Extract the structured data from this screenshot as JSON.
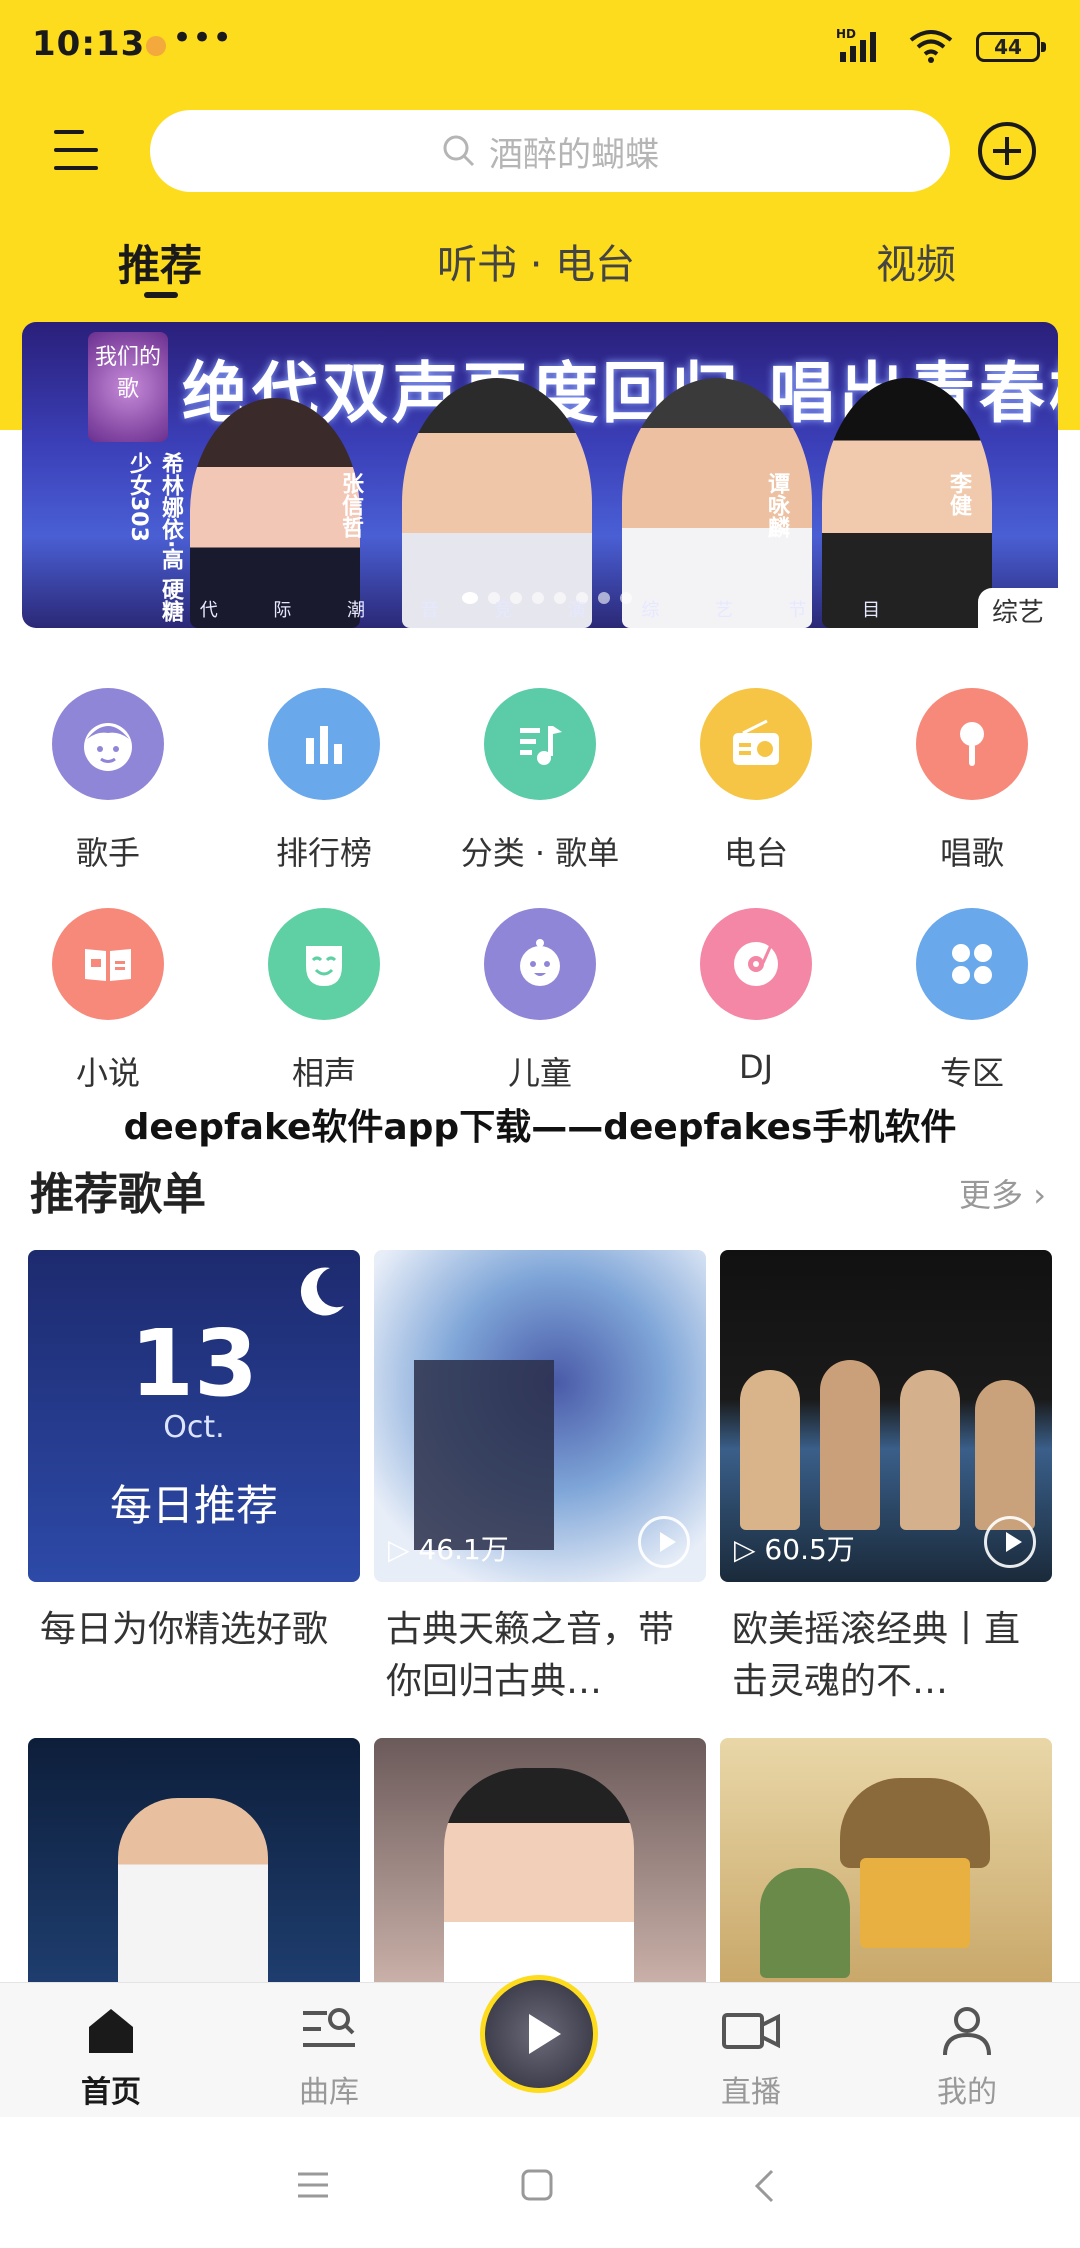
{
  "status_bar": {
    "time": "10:13",
    "dots": "•••",
    "network": "HD",
    "battery": "44"
  },
  "header": {
    "search_placeholder": "酒醉的蝴蝶"
  },
  "tabs": [
    {
      "label": "推荐"
    },
    {
      "label": "听书 · 电台"
    },
    {
      "label": "视频"
    }
  ],
  "banner": {
    "title": "绝代双声再度回归 唱出青春样",
    "logo_text": "我们的歌",
    "vertical_labels": [
      "希林娜依·高 硬糖少女303",
      "张信哲",
      "谭咏麟",
      "李健"
    ],
    "subtitle": [
      "代",
      "际",
      "潮",
      "音",
      "竞",
      "演",
      "综",
      "艺",
      "节",
      "目"
    ],
    "tag": "综艺"
  },
  "categories": [
    {
      "label": "歌手",
      "color": "#8f86d8"
    },
    {
      "label": "排行榜",
      "color": "#6aa8ec"
    },
    {
      "label": "分类 · 歌单",
      "color": "#5ccca8"
    },
    {
      "label": "电台",
      "color": "#f7c545"
    },
    {
      "label": "唱歌",
      "color": "#f7897a"
    },
    {
      "label": "小说",
      "color": "#f7897a"
    },
    {
      "label": "相声",
      "color": "#5fd0a4"
    },
    {
      "label": "儿童",
      "color": "#8f86d8"
    },
    {
      "label": "DJ",
      "color": "#f486a6"
    },
    {
      "label": "专区",
      "color": "#6aa8ec"
    }
  ],
  "watermark_title": "deepfake软件app下载——deepfakes手机软件",
  "playlists_section": {
    "title": "推荐歌单",
    "more": "更多 ›",
    "cards": [
      {
        "title": "每日为你精选好歌",
        "date_day": "13",
        "date_month": "Oct.",
        "cover_text": "每日推荐"
      },
      {
        "title": "古典天籁之音，带你回归古典…",
        "plays": "▷ 46.1万"
      },
      {
        "title": "欧美摇滚经典丨直击灵魂的不…",
        "plays": "▷ 60.5万"
      }
    ]
  },
  "bottom_nav": [
    {
      "label": "首页"
    },
    {
      "label": "曲库"
    },
    {
      "label": "直播"
    },
    {
      "label": "我的"
    }
  ]
}
